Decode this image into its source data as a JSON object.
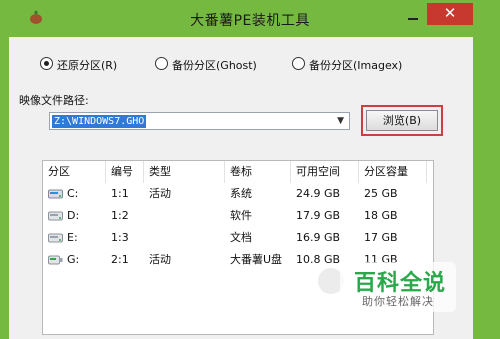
{
  "window": {
    "title": "大番薯PE装机工具",
    "close_label": "✕",
    "minimize_label": "",
    "colors": {
      "frame": "#76b941",
      "close": "#c7392f",
      "selection": "#2f7ad6",
      "highlight": "#c9413a"
    }
  },
  "mode_options": [
    {
      "label": "还原分区(R)",
      "selected": true
    },
    {
      "label": "备份分区(Ghost)",
      "selected": false
    },
    {
      "label": "备份分区(Imagex)",
      "selected": false
    }
  ],
  "image_path": {
    "label": "映像文件路径:",
    "value": "Z:\\WINDOWS7.GHO",
    "dropdown_icon": "chevron-down-icon"
  },
  "browse": {
    "label": "浏览(B)"
  },
  "partition_table": {
    "columns": [
      "分区",
      "编号",
      "类型",
      "卷标",
      "可用空间",
      "分区容量"
    ],
    "rows": [
      {
        "drive": "C:",
        "number": "1:1",
        "type": "活动",
        "label": "系统",
        "free": "24.9 GB",
        "capacity": "25 GB",
        "icon": "hard-drive-icon"
      },
      {
        "drive": "D:",
        "number": "1:2",
        "type": "",
        "label": "软件",
        "free": "17.9 GB",
        "capacity": "18 GB",
        "icon": "hard-drive-icon"
      },
      {
        "drive": "E:",
        "number": "1:3",
        "type": "",
        "label": "文档",
        "free": "16.9 GB",
        "capacity": "17 GB",
        "icon": "hard-drive-icon"
      },
      {
        "drive": "G:",
        "number": "2:1",
        "type": "活动",
        "label": "大番薯U盘",
        "free": "10.8 GB",
        "capacity": "11 GB",
        "icon": "usb-drive-icon"
      }
    ]
  },
  "watermark": {
    "title": "百科全说",
    "subtitle": "助你轻松解决"
  }
}
